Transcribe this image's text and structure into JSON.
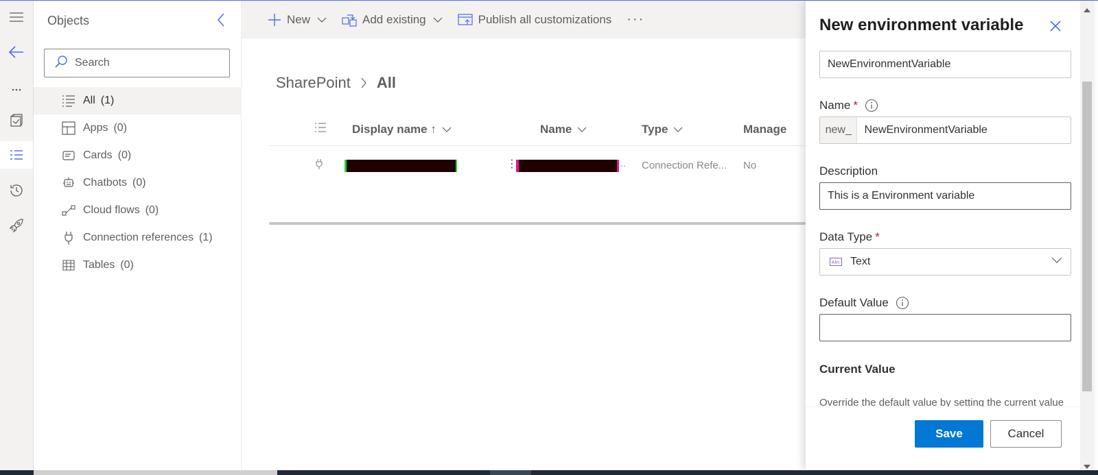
{
  "rail": {
    "items": [
      "menu-icon",
      "back-arrow-icon",
      "more-icon",
      "object-icon",
      "list-icon",
      "history-icon",
      "rocket-icon"
    ]
  },
  "objects": {
    "title": "Objects",
    "search_placeholder": "Search",
    "items": [
      {
        "label": "All",
        "count": "(1)",
        "icon": "list-icon"
      },
      {
        "label": "Apps",
        "count": "(0)",
        "icon": "apps-icon"
      },
      {
        "label": "Cards",
        "count": "(0)",
        "icon": "card-icon"
      },
      {
        "label": "Chatbots",
        "count": "(0)",
        "icon": "chatbot-icon"
      },
      {
        "label": "Cloud flows",
        "count": "(0)",
        "icon": "flow-icon"
      },
      {
        "label": "Connection references",
        "count": "(1)",
        "icon": "plug-icon"
      },
      {
        "label": "Tables",
        "count": "(0)",
        "icon": "table-icon"
      }
    ]
  },
  "commandbar": {
    "new_label": "New",
    "add_existing_label": "Add existing",
    "publish_label": "Publish all customizations",
    "more_label": "···"
  },
  "breadcrumb": {
    "parent": "SharePoint",
    "current": "All"
  },
  "grid": {
    "columns": {
      "display_name": "Display name ↑",
      "name": "Name",
      "type": "Type",
      "managed": "Manage"
    },
    "rows": [
      {
        "type": "Connection Refe...",
        "managed": "No"
      }
    ]
  },
  "panel": {
    "title": "New environment variable",
    "display_name_value": "NewEnvironmentVariable",
    "name_label": "Name",
    "name_prefix": "new_",
    "name_value": "NewEnvironmentVariable",
    "description_label": "Description",
    "description_value": "This is a Environment variable",
    "data_type_label": "Data Type",
    "data_type_value": "Text",
    "data_type_icon_text": "Abc",
    "default_value_label": "Default Value",
    "default_value_value": "",
    "current_value_label": "Current Value",
    "current_value_desc": "Override the default value by setting the current value",
    "required_marker": "*",
    "save_label": "Save",
    "cancel_label": "Cancel"
  },
  "colors": {
    "accent": "#0078d4",
    "required": "#a4262c",
    "link_blue": "#4f6bed"
  }
}
